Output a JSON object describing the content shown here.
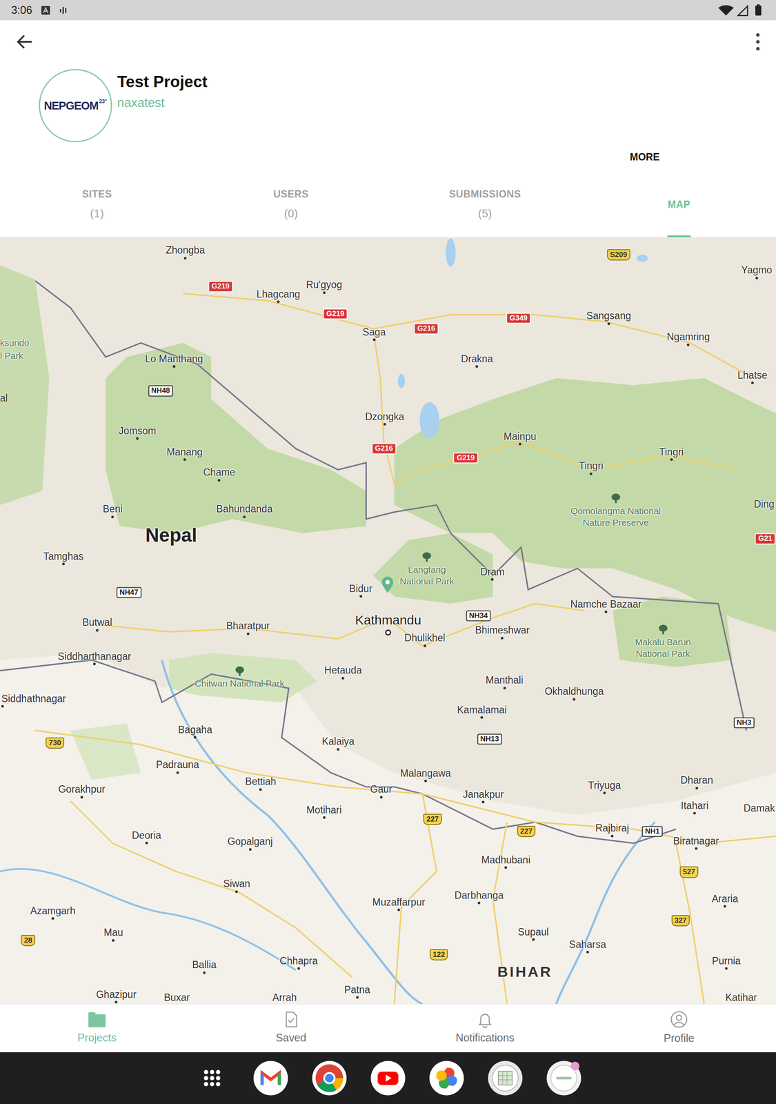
{
  "status_bar": {
    "time": "3:06"
  },
  "project": {
    "logo": {
      "text": "NEPGEOM",
      "superscript": "23°"
    },
    "title": "Test Project",
    "subtitle": "naxatest"
  },
  "more_button": "MORE",
  "tabs": [
    {
      "label": "SITES",
      "count": "(1)",
      "selected": false
    },
    {
      "label": "USERS",
      "count": "(0)",
      "selected": false
    },
    {
      "label": "SUBMISSIONS",
      "count": "(5)",
      "selected": false
    },
    {
      "label": "MAP",
      "count": "",
      "selected": true
    }
  ],
  "map": {
    "labels": [
      {
        "text": "Zhongba",
        "kind": "city"
      },
      {
        "text": "G219",
        "kind": "road-red"
      },
      {
        "text": "Lhagcang",
        "kind": "city"
      },
      {
        "text": "Ru'gyog",
        "kind": "city"
      },
      {
        "text": "G219",
        "kind": "road-red"
      },
      {
        "text": "Saga",
        "kind": "city"
      },
      {
        "text": "G216",
        "kind": "road-red"
      },
      {
        "text": "G349",
        "kind": "road-red"
      },
      {
        "text": "S209",
        "kind": "road-yellow"
      },
      {
        "text": "Yagmo",
        "kind": "city"
      },
      {
        "text": "Sangsang",
        "kind": "city"
      },
      {
        "text": "Ngamring",
        "kind": "city"
      },
      {
        "text": "Lhatse",
        "kind": "city"
      },
      {
        "text": "ksundo",
        "kind": "park-text"
      },
      {
        "text": "l Park",
        "kind": "park-text"
      },
      {
        "text": "al",
        "kind": "label"
      },
      {
        "text": "Lo Manthang",
        "kind": "city"
      },
      {
        "text": "NH48",
        "kind": "road-white"
      },
      {
        "text": "Drakna",
        "kind": "city"
      },
      {
        "text": "Dzongka",
        "kind": "city"
      },
      {
        "text": "G216",
        "kind": "road-red"
      },
      {
        "text": "G219",
        "kind": "road-red"
      },
      {
        "text": "Mainpu",
        "kind": "city"
      },
      {
        "text": "Jomsom",
        "kind": "city"
      },
      {
        "text": "Manang",
        "kind": "city"
      },
      {
        "text": "Chame",
        "kind": "city"
      },
      {
        "text": "Tingri",
        "kind": "city"
      },
      {
        "text": "Tingri",
        "kind": "city"
      },
      {
        "kind": "park",
        "lines": [
          "Qomolangma National",
          "Nature Preserve"
        ]
      },
      {
        "text": "Ding",
        "kind": "label"
      },
      {
        "text": "G21",
        "kind": "road-red"
      },
      {
        "text": "Beni",
        "kind": "city"
      },
      {
        "text": "Bahundanda",
        "kind": "city"
      },
      {
        "text": "Nepal",
        "kind": "country"
      },
      {
        "text": "Tamghas",
        "kind": "city"
      },
      {
        "kind": "park",
        "lines": [
          "Langtang",
          "National Park"
        ]
      },
      {
        "text": "Dram",
        "kind": "city"
      },
      {
        "text": "Bidur",
        "kind": "city"
      },
      {
        "text": "NH47",
        "kind": "road-white"
      },
      {
        "text": "Kathmandu",
        "kind": "capital"
      },
      {
        "text": "NH34",
        "kind": "road-white"
      },
      {
        "text": "Namche Bazaar",
        "kind": "city"
      },
      {
        "text": "Bhimeshwar",
        "kind": "city"
      },
      {
        "text": "Dhulikhel",
        "kind": "city"
      },
      {
        "kind": "park",
        "lines": [
          "Makalu Barun",
          "National Park"
        ]
      },
      {
        "text": "Butwal",
        "kind": "city"
      },
      {
        "text": "Bharatpur",
        "kind": "city"
      },
      {
        "text": "Siddharthanagar",
        "kind": "city"
      },
      {
        "text": "Hetauda",
        "kind": "city"
      },
      {
        "kind": "park",
        "lines": [
          "Chitwan National Park"
        ]
      },
      {
        "text": "Manthali",
        "kind": "city"
      },
      {
        "text": "Okhaldhunga",
        "kind": "city"
      },
      {
        "text": "Siddhathnagar",
        "kind": "city"
      },
      {
        "text": "Kamalamai",
        "kind": "city"
      },
      {
        "text": "NH3",
        "kind": "road-white"
      },
      {
        "text": "730",
        "kind": "road-yellow"
      },
      {
        "text": "Bagaha",
        "kind": "city"
      },
      {
        "text": "Kalaiya",
        "kind": "city"
      },
      {
        "text": "NH13",
        "kind": "road-white"
      },
      {
        "text": "Padrauna",
        "kind": "city"
      },
      {
        "text": "Malangawa",
        "kind": "city"
      },
      {
        "text": "Dharan",
        "kind": "city"
      },
      {
        "text": "Gorakhpur",
        "kind": "city"
      },
      {
        "text": "Bettiah",
        "kind": "city"
      },
      {
        "text": "Gaur",
        "kind": "city"
      },
      {
        "text": "Triyuga",
        "kind": "city"
      },
      {
        "text": "Janakpur",
        "kind": "city"
      },
      {
        "text": "Motihari",
        "kind": "city"
      },
      {
        "text": "227",
        "kind": "road-yellow"
      },
      {
        "text": "227",
        "kind": "road-yellow"
      },
      {
        "text": "Itahari",
        "kind": "city"
      },
      {
        "text": "Damak",
        "kind": "label"
      },
      {
        "text": "Rajbiraj",
        "kind": "city"
      },
      {
        "text": "NH1",
        "kind": "road-white"
      },
      {
        "text": "Biratnagar",
        "kind": "city"
      },
      {
        "text": "Deoria",
        "kind": "city"
      },
      {
        "text": "Gopalganj",
        "kind": "city"
      },
      {
        "text": "Madhubani",
        "kind": "city"
      },
      {
        "text": "527",
        "kind": "road-yellow"
      },
      {
        "text": "Siwan",
        "kind": "city"
      },
      {
        "text": "Darbhanga",
        "kind": "city"
      },
      {
        "text": "Muzaffarpur",
        "kind": "city"
      },
      {
        "text": "Araria",
        "kind": "city"
      },
      {
        "text": "Azamgarh",
        "kind": "city"
      },
      {
        "text": "327",
        "kind": "road-yellow"
      },
      {
        "text": "Mau",
        "kind": "city"
      },
      {
        "text": "28",
        "kind": "road-yellow"
      },
      {
        "text": "Supaul",
        "kind": "city"
      },
      {
        "text": "Saharsa",
        "kind": "city"
      },
      {
        "text": "122",
        "kind": "road-yellow"
      },
      {
        "text": "Chhapra",
        "kind": "city"
      },
      {
        "text": "Purnia",
        "kind": "city"
      },
      {
        "text": "Ballia",
        "kind": "city"
      },
      {
        "text": "BIHAR",
        "kind": "region"
      },
      {
        "text": "Ghazipur",
        "kind": "city"
      },
      {
        "text": "Buxar",
        "kind": "city"
      },
      {
        "text": "Arrah",
        "kind": "city"
      },
      {
        "text": "Patna",
        "kind": "city"
      },
      {
        "text": "Katihar",
        "kind": "label"
      }
    ]
  },
  "bottom_nav": [
    {
      "label": "Projects",
      "selected": true
    },
    {
      "label": "Saved",
      "selected": false
    },
    {
      "label": "Notifications",
      "selected": false
    },
    {
      "label": "Profile",
      "selected": false
    }
  ]
}
